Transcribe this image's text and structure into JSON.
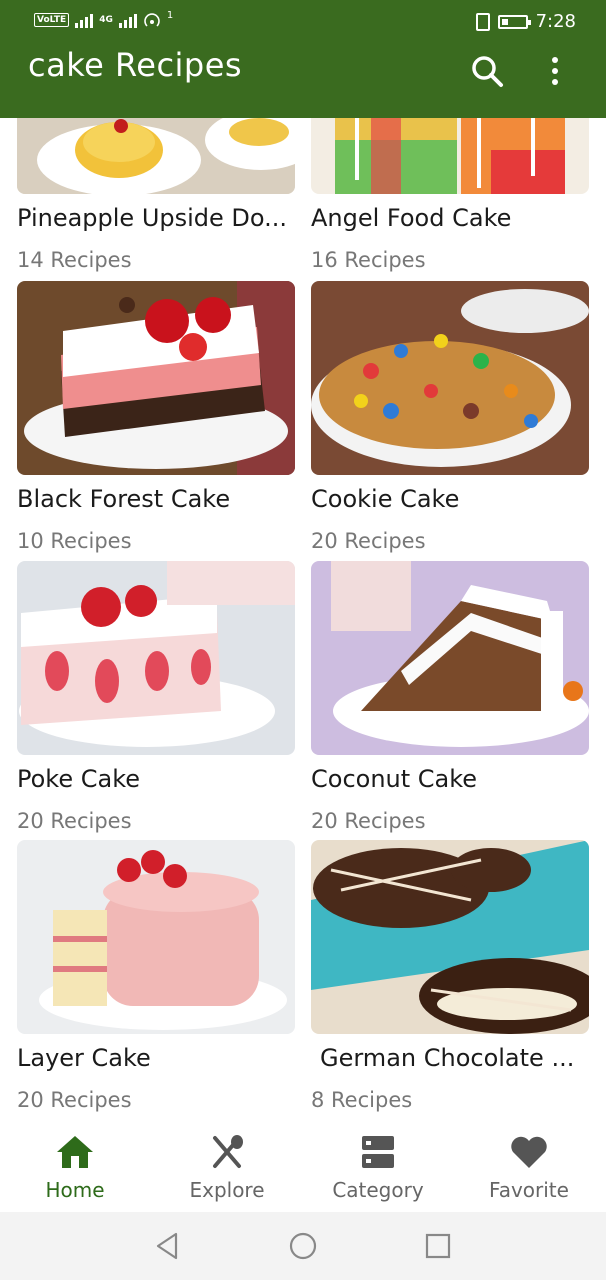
{
  "status_bar": {
    "volte": "VoLTE",
    "network": "4G",
    "hotspot_badge": "1",
    "time": "7:28"
  },
  "app_bar": {
    "title": "cake Recipes",
    "search_icon": "search-icon",
    "more_icon": "more-vert-icon"
  },
  "categories": [
    {
      "name": "Pineapple Upside Do...",
      "count": "14 Recipes",
      "image": "pineapple-upside-down-cake"
    },
    {
      "name": "Angel Food Cake",
      "count": "16 Recipes",
      "image": "rainbow-angel-food-cake"
    },
    {
      "name": "Black Forest Cake",
      "count": "10 Recipes",
      "image": "cherry-layered-cake"
    },
    {
      "name": "Cookie Cake",
      "count": "20 Recipes",
      "image": "candy-cookie-cake"
    },
    {
      "name": "Poke Cake",
      "count": "20 Recipes",
      "image": "strawberry-poke-cake"
    },
    {
      "name": "Coconut Cake",
      "count": "20 Recipes",
      "image": "carrot-layer-cake"
    },
    {
      "name": "Layer Cake",
      "count": "20 Recipes",
      "image": "pink-layer-cake"
    },
    {
      "name": "German Chocolate ...",
      "count": "8 Recipes",
      "image": "chocolate-cookies"
    }
  ],
  "bottom_nav": [
    {
      "label": "Home",
      "icon": "home-icon",
      "active": true
    },
    {
      "label": "Explore",
      "icon": "utensils-icon",
      "active": false
    },
    {
      "label": "Category",
      "icon": "category-icon",
      "active": false
    },
    {
      "label": "Favorite",
      "icon": "heart-icon",
      "active": false
    }
  ],
  "colors": {
    "primary": "#3a6b1f",
    "active_nav": "#2e6b1a",
    "inactive_nav": "#666666"
  }
}
